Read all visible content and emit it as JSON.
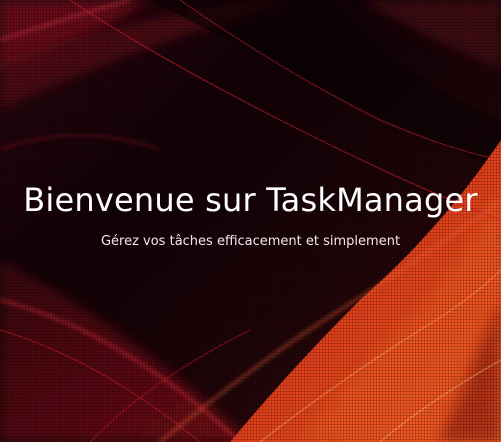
{
  "hero": {
    "title": "Bienvenue sur TaskManager",
    "subtitle": "Gérez vos tâches efficacement et simplement"
  },
  "colors": {
    "background": "#0a0205",
    "accent_red": "#c81227",
    "accent_orange": "#ef4a1c",
    "text": "#ffffff"
  }
}
